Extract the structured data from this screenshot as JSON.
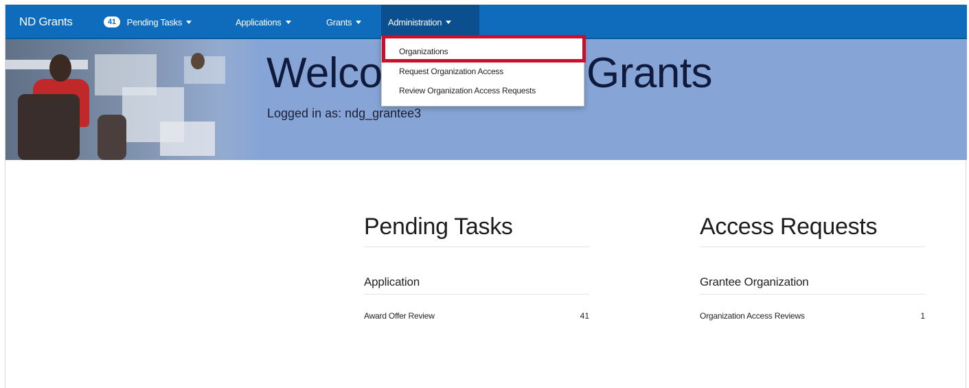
{
  "navbar": {
    "brand": "ND Grants",
    "pending_badge": "41",
    "pending_label": "Pending Tasks",
    "applications_label": "Applications",
    "grants_label": "Grants",
    "administration_label": "Administration"
  },
  "banner": {
    "welcome_left": "Welco",
    "welcome_right": "Grants",
    "logged_in": "Logged in as: ndg_grantee3"
  },
  "admin_menu": {
    "items": [
      {
        "label": "Organizations",
        "highlighted": true
      },
      {
        "label": "Request Organization Access"
      },
      {
        "label": "Review Organization Access Requests"
      }
    ]
  },
  "pending_tasks": {
    "title": "Pending Tasks",
    "section": "Application",
    "rows": [
      {
        "label": "Award Offer Review",
        "count": "41"
      }
    ]
  },
  "access_requests": {
    "title": "Access Requests",
    "section": "Grantee Organization",
    "rows": [
      {
        "label": "Organization Access Reviews",
        "count": "1"
      }
    ]
  },
  "colors": {
    "navbar": "#0f6cbd",
    "banner": "#86a5d6",
    "highlight": "#c8102e"
  }
}
